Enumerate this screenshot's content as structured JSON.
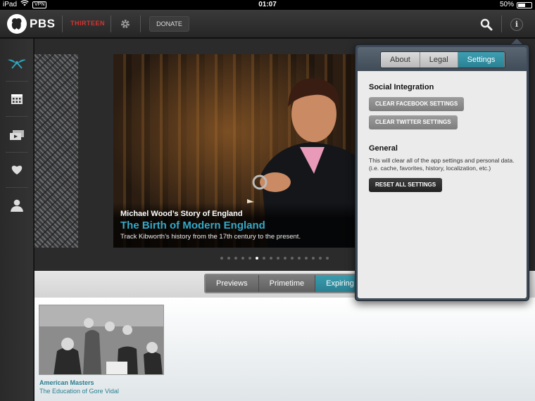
{
  "status_bar": {
    "device": "iPad",
    "vpn": "VPN",
    "time": "01:07",
    "battery_text": "50%",
    "battery_level": 0.5
  },
  "topbar": {
    "logo_text": "PBS",
    "station": "THIRTEEN",
    "donate_label": "DONATE",
    "info_label": "i"
  },
  "sidebar": {
    "items": [
      {
        "icon": "featured-icon"
      },
      {
        "icon": "calendar-icon"
      },
      {
        "icon": "videos-icon"
      },
      {
        "icon": "heart-icon"
      },
      {
        "icon": "user-icon"
      }
    ]
  },
  "hero": {
    "series": "Michael Wood’s Story of England",
    "title": "The Birth of Modern England",
    "description": "Track Kibworth’s history from the 17th century to the present.",
    "dot_count": 16,
    "active_dot": 5
  },
  "filter_tabs": {
    "items": [
      "Previews",
      "Primetime",
      "Expiring S"
    ],
    "active_index": 2
  },
  "content": {
    "items": [
      {
        "series": "American Masters",
        "title": "The Education of Gore Vidal"
      }
    ]
  },
  "popover": {
    "tabs": [
      "About",
      "Legal",
      "Settings"
    ],
    "active_tab": 2,
    "social_title": "Social Integration",
    "clear_facebook": "CLEAR FACEBOOK SETTINGS",
    "clear_twitter": "CLEAR TWITTER SETTINGS",
    "general_title": "General",
    "general_desc": "This will clear all of the app settings and personal data. (i.e. cache, favorites, history, localization, etc.)",
    "reset_label": "RESET ALL SETTINGS"
  },
  "colors": {
    "accent": "#2a8193",
    "caption_title": "#35a9c8",
    "station_red": "#d8332f"
  }
}
